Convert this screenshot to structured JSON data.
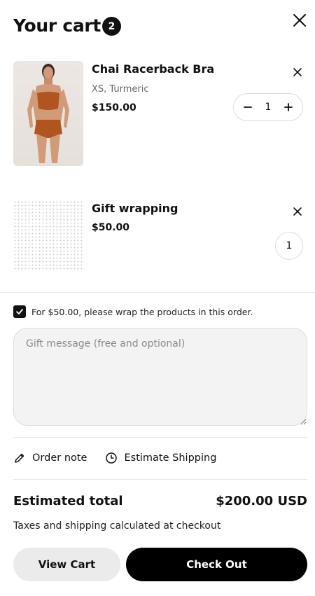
{
  "cart": {
    "title": "Your cart",
    "count": "2"
  },
  "items": [
    {
      "title": "Chai Racerback Bra",
      "variant": "XS, Turmeric",
      "price": "$150.00",
      "quantity": "1"
    },
    {
      "title": "Gift wrapping",
      "price": "$50.00",
      "quantity": "1"
    }
  ],
  "gift": {
    "checked": true,
    "label": "For $50.00, please wrap the products in this order.",
    "message_placeholder": "Gift message (free and optional)"
  },
  "links": {
    "order_note": "Order note",
    "estimate_shipping": "Estimate Shipping"
  },
  "summary": {
    "total_label": "Estimated total",
    "total_value": "$200.00 USD",
    "taxes_note": "Taxes and shipping calculated at checkout"
  },
  "buttons": {
    "view_cart": "View Cart",
    "checkout": "Check Out"
  },
  "icons": {
    "close": "close-icon",
    "remove": "close-icon",
    "minus": "minus-icon",
    "plus": "plus-icon",
    "check": "check-icon",
    "pencil": "pencil-icon",
    "clock": "clock-icon"
  },
  "colors": {
    "primary": "#000000",
    "badge": "#111111",
    "field_bg": "#f3f3f3",
    "secondary_button": "#ebebeb",
    "product_color": "#b0551f"
  }
}
